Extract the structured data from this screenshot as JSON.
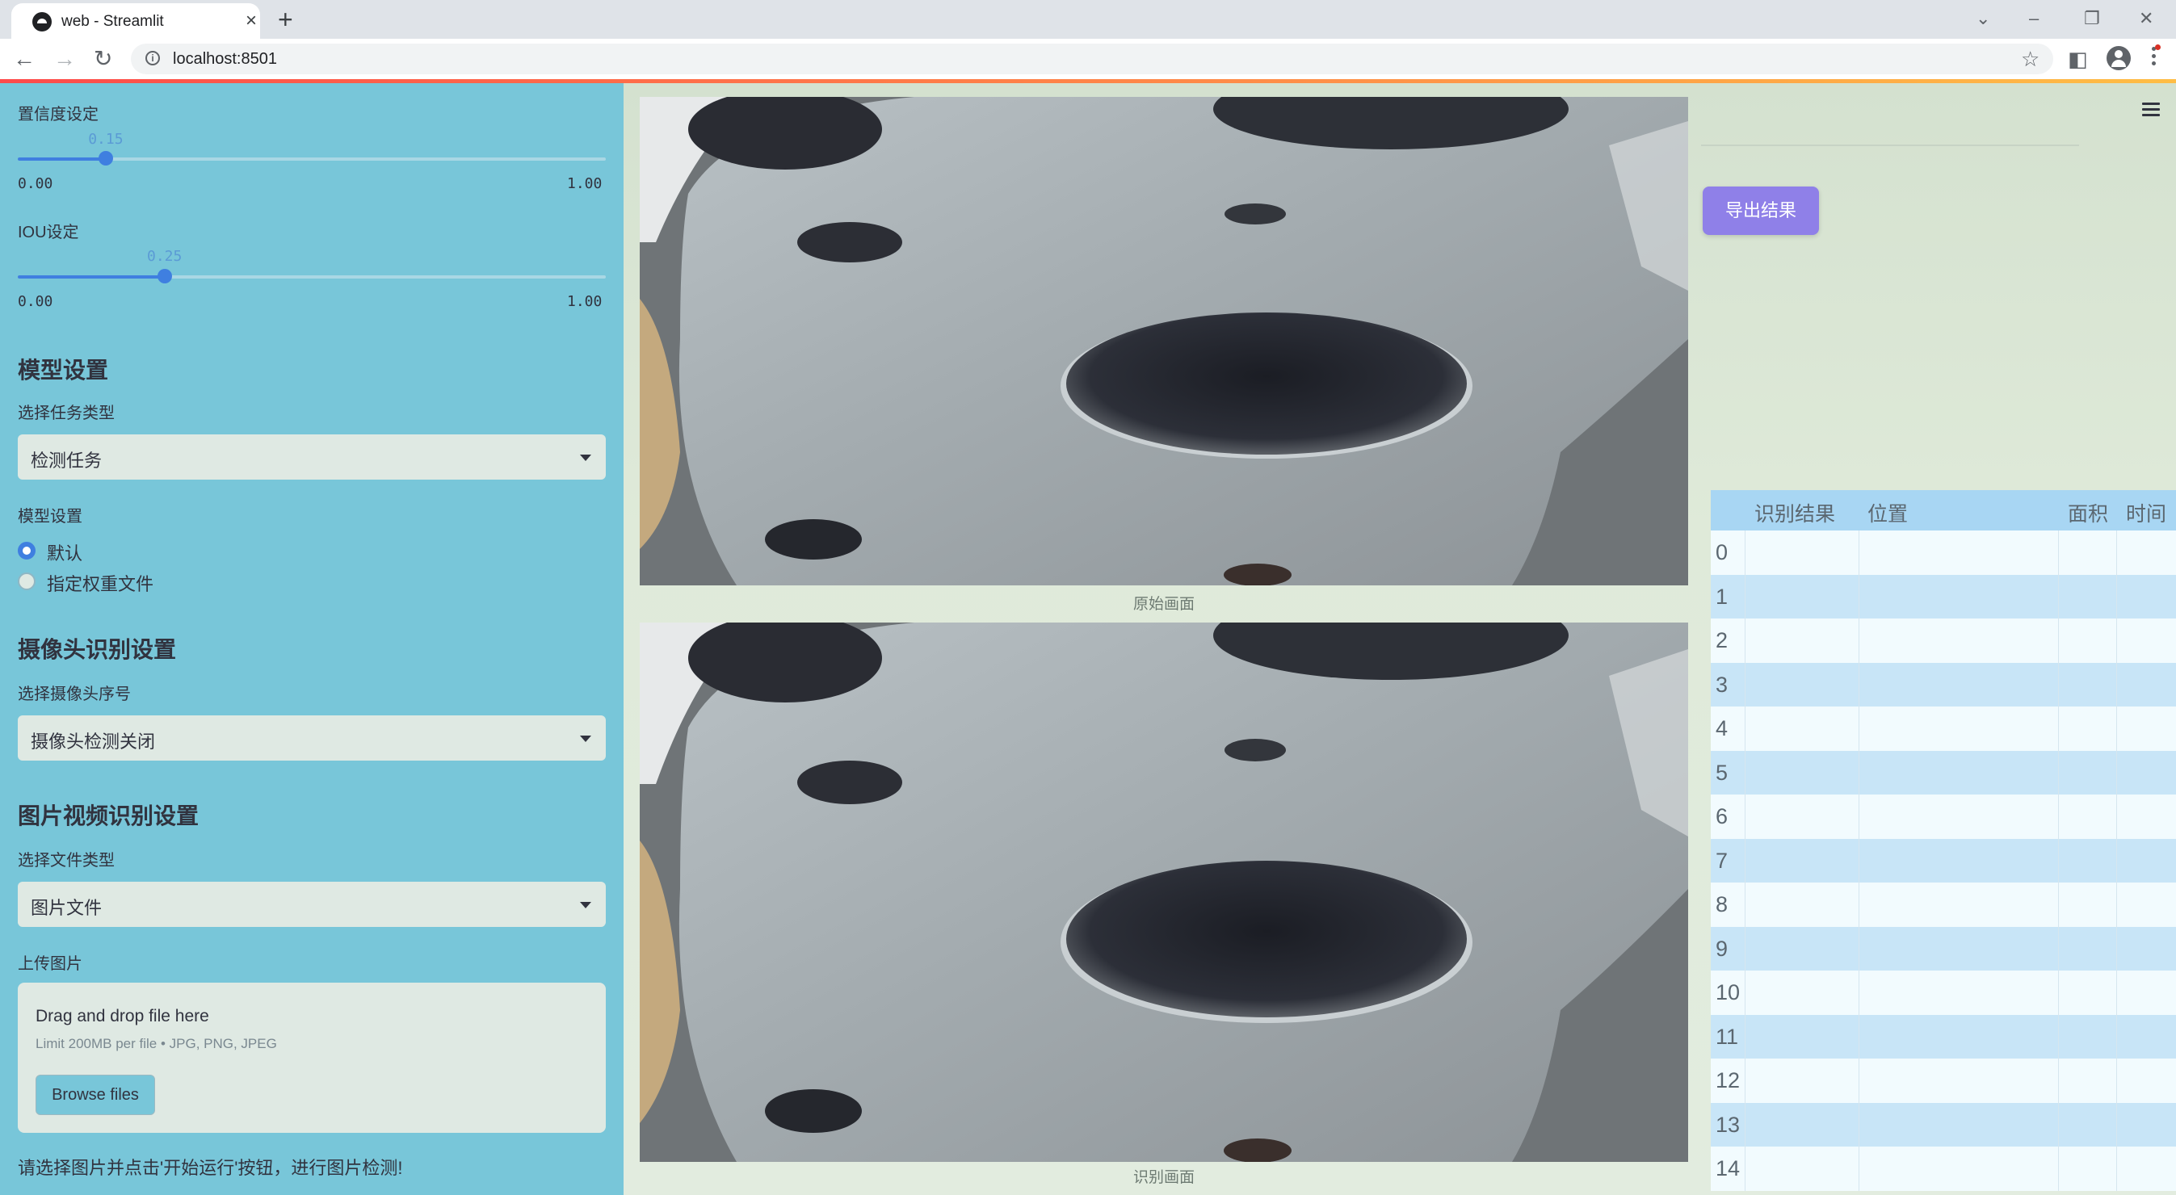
{
  "browser": {
    "tab_title": "web - Streamlit",
    "url": "localhost:8501"
  },
  "sidebar": {
    "confidence": {
      "label": "置信度设定",
      "value": "0.15",
      "value_fraction": 0.15,
      "min": "0.00",
      "max": "1.00"
    },
    "iou": {
      "label": "IOU设定",
      "value": "0.25",
      "value_fraction": 0.25,
      "min": "0.00",
      "max": "1.00"
    },
    "model_section_title": "模型设置",
    "task_type_label": "选择任务类型",
    "task_type_value": "检测任务",
    "model_label": "模型设置",
    "model_options": [
      "默认",
      "指定权重文件"
    ],
    "model_selected": "默认",
    "camera_section_title": "摄像头识别设置",
    "camera_label": "选择摄像头序号",
    "camera_value": "摄像头检测关闭",
    "media_section_title": "图片视频识别设置",
    "file_type_label": "选择文件类型",
    "file_type_value": "图片文件",
    "upload_label": "上传图片",
    "uploader": {
      "main_text": "Drag and drop file here",
      "sub_text": "Limit 200MB per file • JPG, PNG, JPEG",
      "button": "Browse files"
    },
    "hint": "请选择图片并点击'开始运行'按钮，进行图片检测!"
  },
  "main": {
    "original_caption": "原始画面",
    "result_caption": "识别画面",
    "export_button": "导出结果",
    "table": {
      "columns": [
        "识别结果",
        "位置",
        "面积",
        "时间"
      ],
      "rows": [
        "0",
        "1",
        "2",
        "3",
        "4",
        "5",
        "6",
        "7",
        "8",
        "9",
        "10",
        "11",
        "12",
        "13",
        "14"
      ]
    }
  },
  "colors": {
    "sidebar_bg": "#78c6d9",
    "main_bg": "#dfead9",
    "accent": "#3f7fe0",
    "export_button": "#8f80e8",
    "table_header": "#a8d6f3"
  }
}
